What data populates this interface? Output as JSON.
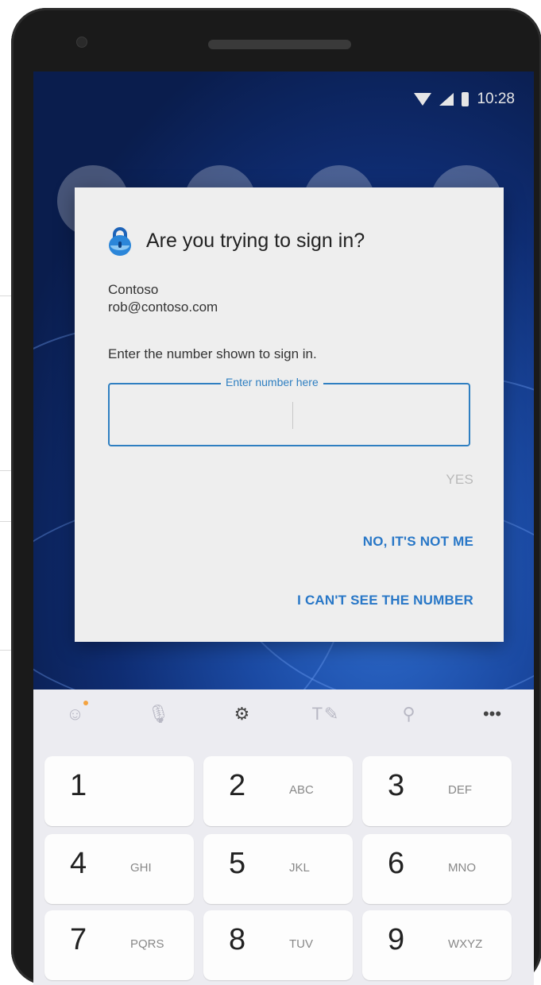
{
  "status_bar": {
    "time": "10:28"
  },
  "dialog": {
    "title": "Are you trying to sign in?",
    "org_name": "Contoso",
    "account": "rob@contoso.com",
    "prompt": "Enter the number shown to sign in.",
    "number_field": {
      "label": "Enter number here",
      "value": ""
    },
    "buttons": {
      "yes": "YES",
      "not_me": "NO, IT'S NOT ME",
      "cant_see": "I CAN'T SEE THE NUMBER"
    }
  },
  "keyboard": {
    "toolbar_icons": [
      "emoji-icon",
      "mic-icon",
      "settings-icon",
      "handwriting-icon",
      "search-icon",
      "more-icon"
    ],
    "more_glyph": "•••",
    "keys": [
      {
        "digit": "1",
        "letters": ""
      },
      {
        "digit": "2",
        "letters": "ABC"
      },
      {
        "digit": "3",
        "letters": "DEF"
      },
      {
        "digit": "4",
        "letters": "GHI"
      },
      {
        "digit": "5",
        "letters": "JKL"
      },
      {
        "digit": "6",
        "letters": "MNO"
      },
      {
        "digit": "7",
        "letters": "PQRS"
      },
      {
        "digit": "8",
        "letters": "TUV"
      },
      {
        "digit": "9",
        "letters": "WXYZ"
      }
    ]
  },
  "colors": {
    "accent": "#2877c7",
    "disabled": "#b9b9b9",
    "dialog_bg": "#eeeeee",
    "keyboard_bg": "#ececf1"
  }
}
